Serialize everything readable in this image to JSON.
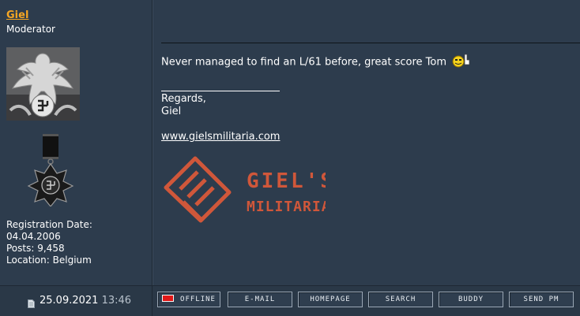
{
  "user": {
    "name": "Giel",
    "rank": "Moderator",
    "registration_date_label": "Registration Date:",
    "registration_date": "04.04.2006",
    "posts_label": "Posts:",
    "posts": "9,458",
    "location_label": "Location:",
    "location": "Belgium"
  },
  "post": {
    "message": "Never managed to find an L/61 before, great score Tom",
    "smiley_icon": "thumbs-up-smiley-icon",
    "signature_line1": "Regards,",
    "signature_line2": "Giel",
    "signature_link": "www.gielsmilitaria.com",
    "logo_text_line1": "GIEL'S",
    "logo_text_line2": "MILITARIA",
    "date": "25.09.2021",
    "time": "13:46"
  },
  "buttons": {
    "offline": "OFFLINE",
    "email": "E-MAIL",
    "homepage": "HOMEPAGE",
    "search": "SEARCH",
    "buddy": "BUDDY",
    "send_pm": "SEND PM"
  },
  "colors": {
    "background": "#2d3c4d",
    "username": "#f5a623",
    "logo": "#d0573a",
    "offline_indicator": "#e01818"
  }
}
